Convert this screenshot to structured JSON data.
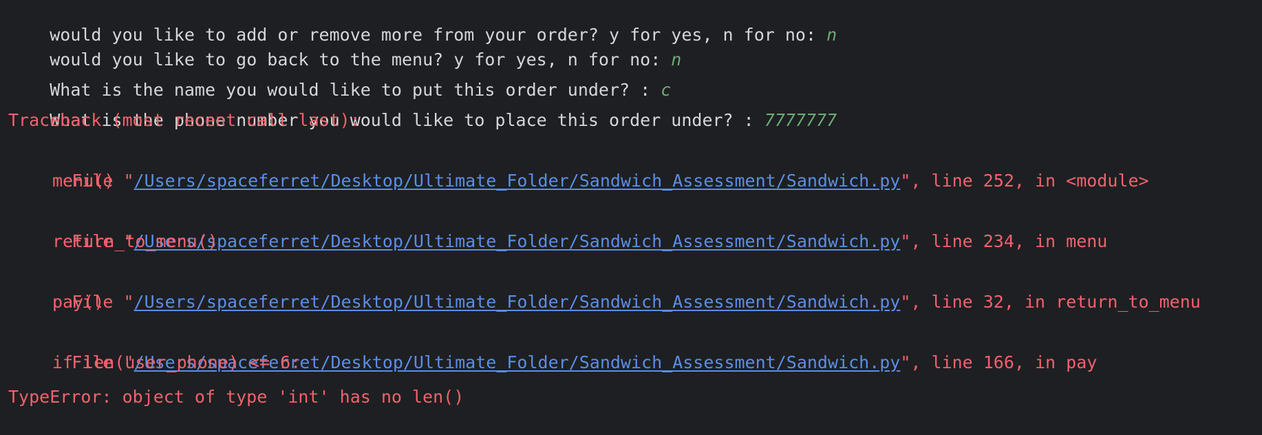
{
  "colors": {
    "background": "#1e1f22",
    "prompt_text": "#d4d6da",
    "user_input": "#6aab73",
    "error_text": "#f0626d",
    "link": "#5a8ee8"
  },
  "console": {
    "prompts": [
      {
        "text": "would you like to add or remove more from your order? y for yes, n for no: ",
        "input": "n"
      },
      {
        "text": "would you like to go back to the menu? y for yes, n for no: ",
        "input": "n"
      },
      {
        "text": "What is the name you would like to put this order under? : ",
        "input": "c"
      },
      {
        "text": "What is the phone number you would like to place this order under? : ",
        "input": "7777777"
      }
    ],
    "traceback": {
      "header": "Traceback (most recent call last):",
      "frames": [
        {
          "prefix": "File \"",
          "path": "/Users/spaceferret/Desktop/Ultimate_Folder/Sandwich_Assessment/Sandwich.py",
          "suffix": "\", line 252, in <module>",
          "code": "menu()"
        },
        {
          "prefix": "File \"",
          "path": "/Users/spaceferret/Desktop/Ultimate_Folder/Sandwich_Assessment/Sandwich.py",
          "suffix": "\", line 234, in menu",
          "code": "return_to_menu()"
        },
        {
          "prefix": "File \"",
          "path": "/Users/spaceferret/Desktop/Ultimate_Folder/Sandwich_Assessment/Sandwich.py",
          "suffix": "\", line 32, in return_to_menu",
          "code": "pay()"
        },
        {
          "prefix": "File \"",
          "path": "/Users/spaceferret/Desktop/Ultimate_Folder/Sandwich_Assessment/Sandwich.py",
          "suffix": "\", line 166, in pay",
          "code": "if len(user_phone) <= 6:"
        }
      ],
      "error": "TypeError: object of type 'int' has no len()"
    }
  }
}
